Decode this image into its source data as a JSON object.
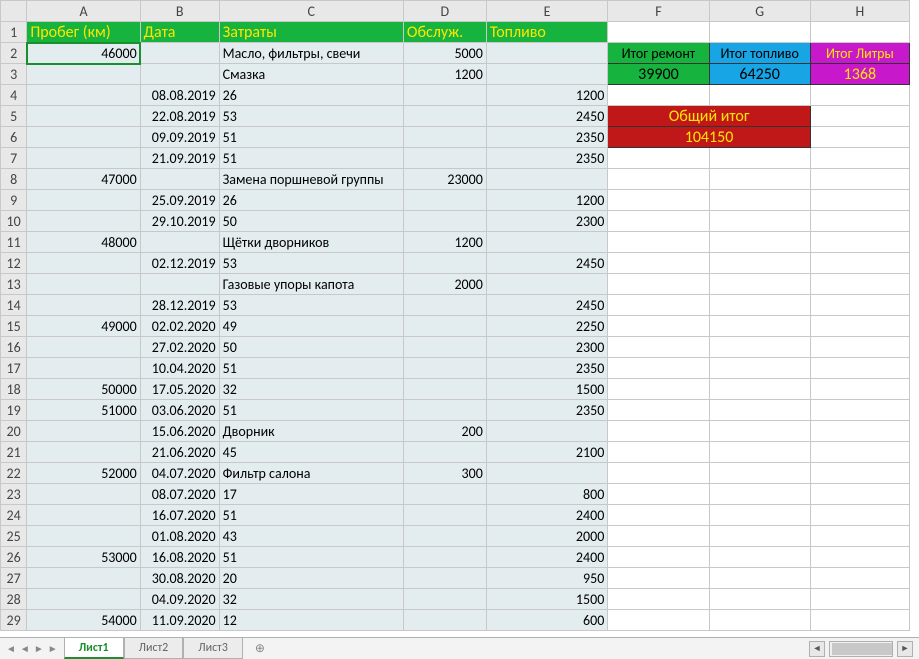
{
  "columns": [
    "A",
    "B",
    "C",
    "D",
    "E",
    "F",
    "G",
    "H"
  ],
  "headerRow": {
    "A": "Пробег (км)",
    "B": "Дата",
    "C": "Затраты",
    "D": "Обслуж.",
    "E": "Топливо"
  },
  "summary": {
    "repair_label": "Итог ремонт",
    "fuel_label": "Итог топливо",
    "liters_label": "Итог Литры",
    "repair_value": "39900",
    "fuel_value": "64250",
    "liters_value": "1368",
    "grand_label": "Общий итог",
    "grand_value": "104150"
  },
  "rows": [
    {
      "n": 2,
      "A": "46000",
      "B": "",
      "C": "Масло, фильтры, свечи",
      "D": "5000",
      "E": ""
    },
    {
      "n": 3,
      "A": "",
      "B": "",
      "C": "Смазка",
      "D": "1200",
      "E": ""
    },
    {
      "n": 4,
      "A": "",
      "B": "08.08.2019",
      "C": "26",
      "D": "",
      "E": "1200"
    },
    {
      "n": 5,
      "A": "",
      "B": "22.08.2019",
      "C": "53",
      "D": "",
      "E": "2450"
    },
    {
      "n": 6,
      "A": "",
      "B": "09.09.2019",
      "C": "51",
      "D": "",
      "E": "2350"
    },
    {
      "n": 7,
      "A": "",
      "B": "21.09.2019",
      "C": "51",
      "D": "",
      "E": "2350"
    },
    {
      "n": 8,
      "A": "47000",
      "B": "",
      "C": "Замена поршневой группы",
      "D": "23000",
      "E": ""
    },
    {
      "n": 9,
      "A": "",
      "B": "25.09.2019",
      "C": "26",
      "D": "",
      "E": "1200"
    },
    {
      "n": 10,
      "A": "",
      "B": "29.10.2019",
      "C": "50",
      "D": "",
      "E": "2300"
    },
    {
      "n": 11,
      "A": "48000",
      "B": "",
      "C": "Щётки дворников",
      "D": "1200",
      "E": ""
    },
    {
      "n": 12,
      "A": "",
      "B": "02.12.2019",
      "C": "53",
      "D": "",
      "E": "2450"
    },
    {
      "n": 13,
      "A": "",
      "B": "",
      "C": "Газовые упоры капота",
      "D": "2000",
      "E": ""
    },
    {
      "n": 14,
      "A": "",
      "B": "28.12.2019",
      "C": "53",
      "D": "",
      "E": "2450"
    },
    {
      "n": 15,
      "A": "49000",
      "B": "02.02.2020",
      "C": "49",
      "D": "",
      "E": "2250"
    },
    {
      "n": 16,
      "A": "",
      "B": "27.02.2020",
      "C": "50",
      "D": "",
      "E": "2300"
    },
    {
      "n": 17,
      "A": "",
      "B": "10.04.2020",
      "C": "51",
      "D": "",
      "E": "2350"
    },
    {
      "n": 18,
      "A": "50000",
      "B": "17.05.2020",
      "C": "32",
      "D": "",
      "E": "1500"
    },
    {
      "n": 19,
      "A": "51000",
      "B": "03.06.2020",
      "C": "51",
      "D": "",
      "E": "2350"
    },
    {
      "n": 20,
      "A": "",
      "B": "15.06.2020",
      "C": "Дворник",
      "D": "200",
      "E": ""
    },
    {
      "n": 21,
      "A": "",
      "B": "21.06.2020",
      "C": "45",
      "D": "",
      "E": "2100"
    },
    {
      "n": 22,
      "A": "52000",
      "B": "04.07.2020",
      "C": "Фильтр салона",
      "D": "300",
      "E": ""
    },
    {
      "n": 23,
      "A": "",
      "B": "08.07.2020",
      "C": "17",
      "D": "",
      "E": "800"
    },
    {
      "n": 24,
      "A": "",
      "B": "16.07.2020",
      "C": "51",
      "D": "",
      "E": "2400"
    },
    {
      "n": 25,
      "A": "",
      "B": "01.08.2020",
      "C": "43",
      "D": "",
      "E": "2000"
    },
    {
      "n": 26,
      "A": "53000",
      "B": "16.08.2020",
      "C": "51",
      "D": "",
      "E": "2400"
    },
    {
      "n": 27,
      "A": "",
      "B": "30.08.2020",
      "C": "20",
      "D": "",
      "E": "950"
    },
    {
      "n": 28,
      "A": "",
      "B": "04.09.2020",
      "C": "32",
      "D": "",
      "E": "1500"
    },
    {
      "n": 29,
      "A": "54000",
      "B": "11.09.2020",
      "C": "12",
      "D": "",
      "E": "600"
    }
  ],
  "tabs": {
    "active": "Лист1",
    "others": [
      "Лист2",
      "Лист3"
    ]
  },
  "chart_data": {
    "type": "table",
    "title": "Vehicle expense log",
    "columns": [
      "Пробег (км)",
      "Дата",
      "Затраты",
      "Обслуж.",
      "Топливо"
    ],
    "rows": [
      [
        46000,
        "",
        "Масло, фильтры, свечи",
        5000,
        null
      ],
      [
        null,
        "",
        "Смазка",
        1200,
        null
      ],
      [
        null,
        "08.08.2019",
        "26",
        null,
        1200
      ],
      [
        null,
        "22.08.2019",
        "53",
        null,
        2450
      ],
      [
        null,
        "09.09.2019",
        "51",
        null,
        2350
      ],
      [
        null,
        "21.09.2019",
        "51",
        null,
        2350
      ],
      [
        47000,
        "",
        "Замена поршневой группы",
        23000,
        null
      ],
      [
        null,
        "25.09.2019",
        "26",
        null,
        1200
      ],
      [
        null,
        "29.10.2019",
        "50",
        null,
        2300
      ],
      [
        48000,
        "",
        "Щётки дворников",
        1200,
        null
      ],
      [
        null,
        "02.12.2019",
        "53",
        null,
        2450
      ],
      [
        null,
        "",
        "Газовые упоры капота",
        2000,
        null
      ],
      [
        null,
        "28.12.2019",
        "53",
        null,
        2450
      ],
      [
        49000,
        "02.02.2020",
        "49",
        null,
        2250
      ],
      [
        null,
        "27.02.2020",
        "50",
        null,
        2300
      ],
      [
        null,
        "10.04.2020",
        "51",
        null,
        2350
      ],
      [
        50000,
        "17.05.2020",
        "32",
        null,
        1500
      ],
      [
        51000,
        "03.06.2020",
        "51",
        null,
        2350
      ],
      [
        null,
        "15.06.2020",
        "Дворник",
        200,
        null
      ],
      [
        null,
        "21.06.2020",
        "45",
        null,
        2100
      ],
      [
        52000,
        "04.07.2020",
        "Фильтр салона",
        300,
        null
      ],
      [
        null,
        "08.07.2020",
        "17",
        null,
        800
      ],
      [
        null,
        "16.07.2020",
        "51",
        null,
        2400
      ],
      [
        null,
        "01.08.2020",
        "43",
        null,
        2000
      ],
      [
        53000,
        "16.08.2020",
        "51",
        null,
        2400
      ],
      [
        null,
        "30.08.2020",
        "20",
        null,
        950
      ],
      [
        null,
        "04.09.2020",
        "32",
        null,
        1500
      ],
      [
        54000,
        "11.09.2020",
        "12",
        null,
        600
      ]
    ],
    "totals": {
      "Итог ремонт": 39900,
      "Итог топливо": 64250,
      "Итог Литры": 1368,
      "Общий итог": 104150
    }
  }
}
